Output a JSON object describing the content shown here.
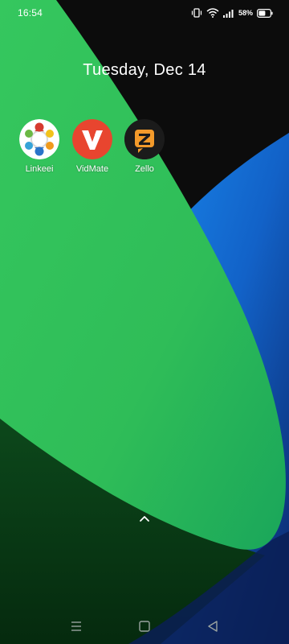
{
  "status_bar": {
    "time": "16:54",
    "battery_percent": "58%",
    "icons": [
      "vibrate-icon",
      "wifi-icon",
      "signal-icon",
      "battery-icon"
    ]
  },
  "home": {
    "date": "Tuesday, Dec 14",
    "apps": [
      {
        "label": "Linkeei",
        "icon": "linkeei-icon"
      },
      {
        "label": "VidMate",
        "icon": "vidmate-icon"
      },
      {
        "label": "Zello",
        "icon": "zello-icon"
      }
    ],
    "swipe_indicator": "chevron-up-icon"
  },
  "navigation_bar": {
    "buttons": [
      "menu-icon",
      "home-square-icon",
      "back-triangle-icon"
    ]
  },
  "colors": {
    "wallpaper_black": "#0c0c0c",
    "wallpaper_green": "#33c25c",
    "wallpaper_dark_green": "#0a3a16",
    "wallpaper_blue": "#1670d8",
    "wallpaper_navy": "#0c2a6e",
    "vidmate_red": "#e8452f",
    "zello_orange": "#f39a2b"
  }
}
